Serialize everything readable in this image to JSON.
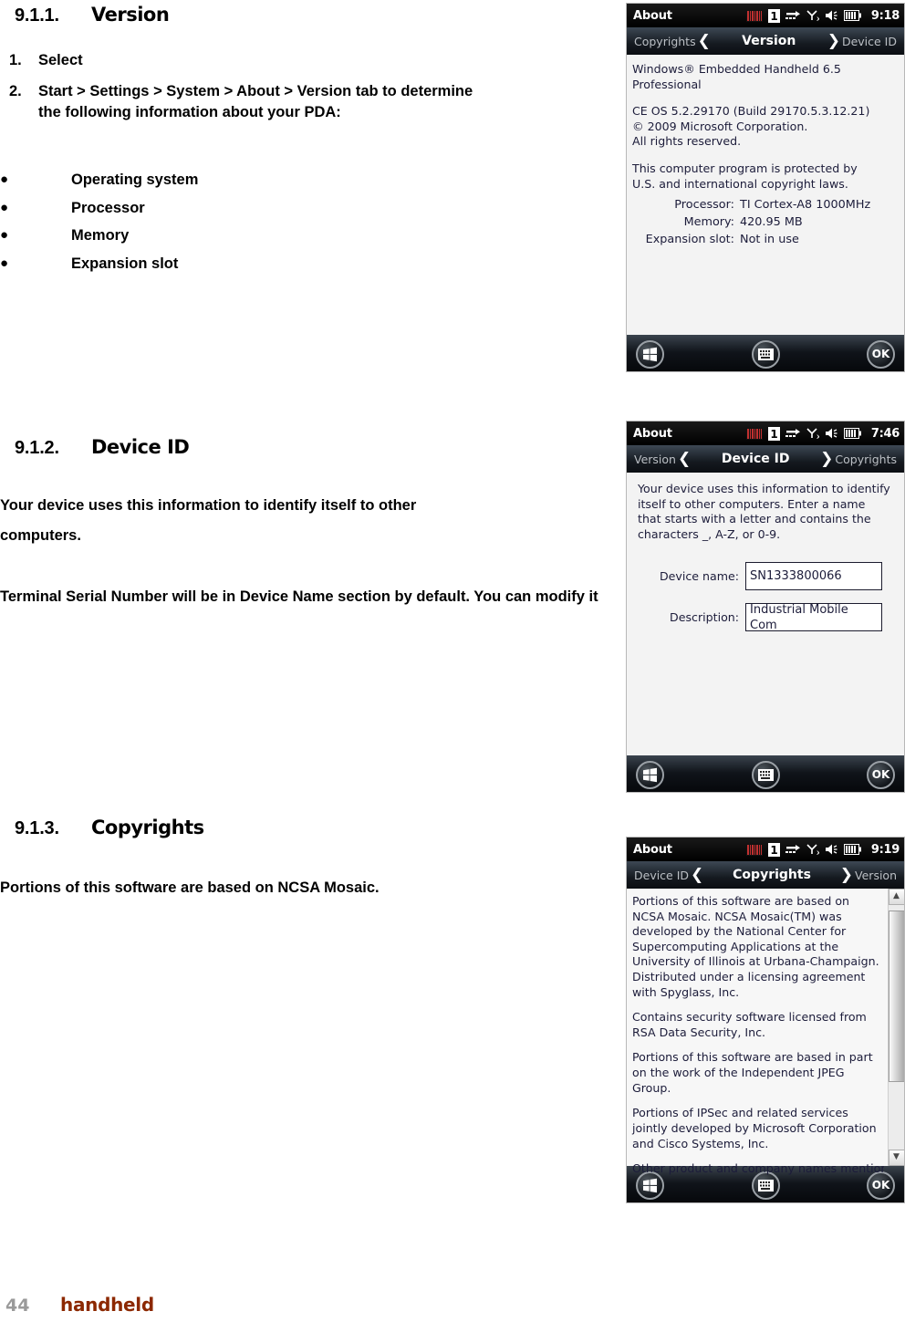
{
  "document": {
    "sections": [
      {
        "number": "9.1.1.",
        "title": "Version",
        "steps": [
          {
            "marker": "1.",
            "text": "Select"
          },
          {
            "marker": "2.",
            "text": "Start > Settings > System > About > Version tab to determine the following information about your PDA:"
          }
        ],
        "bullets": [
          "Operating system",
          "Processor",
          "Memory",
          "Expansion slot"
        ]
      },
      {
        "number": "9.1.2.",
        "title": "Device ID",
        "para1": "Your device uses this information to identify itself to other computers.",
        "para2": "Terminal Serial Number will be in Device Name section by default. You can modify it"
      },
      {
        "number": "9.1.3.",
        "title": "Copyrights",
        "para1": "Portions of this software are based on NCSA Mosaic."
      }
    ]
  },
  "screenshots": {
    "version": {
      "titlebar": {
        "app": "About",
        "clock": "9:18"
      },
      "tabs": {
        "left": "Copyrights",
        "center": "Version",
        "right": "Device ID"
      },
      "lines": [
        "Windows® Embedded Handheld 6.5 Professional",
        "CE OS 5.2.29170 (Build 29170.5.3.12.21)",
        " © 2009 Microsoft Corporation.",
        "All rights reserved.",
        "This computer program is protected by",
        "U.S. and international copyright laws."
      ],
      "specs": [
        {
          "label": "Processor:",
          "value": "TI Cortex-A8 1000MHz"
        },
        {
          "label": "Memory:",
          "value": "420.95 MB"
        },
        {
          "label": "Expansion slot:",
          "value": "Not in use"
        }
      ],
      "taskbar": {
        "start": "start-icon",
        "keyboard": "keyboard-icon",
        "ok": "OK"
      }
    },
    "device_id": {
      "titlebar": {
        "app": "About",
        "clock": "7:46"
      },
      "tabs": {
        "left": "Version",
        "center": "Device ID",
        "right": "Copyrights"
      },
      "description": "Your device uses this information to identify itself to other computers. Enter a name that starts with a letter and contains the characters _, A-Z, or 0-9.",
      "fields": [
        {
          "label": "Device name:",
          "value": "SN1333800066"
        },
        {
          "label": "Description:",
          "value": "Industrial Mobile Com"
        }
      ],
      "taskbar": {
        "start": "start-icon",
        "keyboard": "keyboard-icon",
        "ok": "OK"
      }
    },
    "copyrights": {
      "titlebar": {
        "app": "About",
        "clock": "9:19"
      },
      "tabs": {
        "left": "Device ID",
        "center": "Copyrights",
        "right": "Version"
      },
      "paragraphs": [
        "Portions of this software are based on NCSA Mosaic. NCSA Mosaic(TM) was developed by the National Center for Supercomputing Applications at the University of Illinois at Urbana-Champaign. Distributed under a licensing agreement with Spyglass, Inc.",
        "Contains security software licensed from RSA Data Security, Inc.",
        "Portions of this software are based in part on the work of the Independent JPEG Group.",
        "Portions of IPSec and related services jointly developed by Microsoft Corporation and Cisco Systems, Inc.",
        "Other product and company names mentioned"
      ],
      "taskbar": {
        "start": "start-icon",
        "keyboard": "keyboard-icon",
        "ok": "OK"
      }
    }
  },
  "footer": {
    "page": "44",
    "brand": "handheld"
  },
  "colors": {
    "brand": "#8c2800",
    "page_number": "#9a9a9a",
    "barcode_icon": "#b02a2a"
  }
}
